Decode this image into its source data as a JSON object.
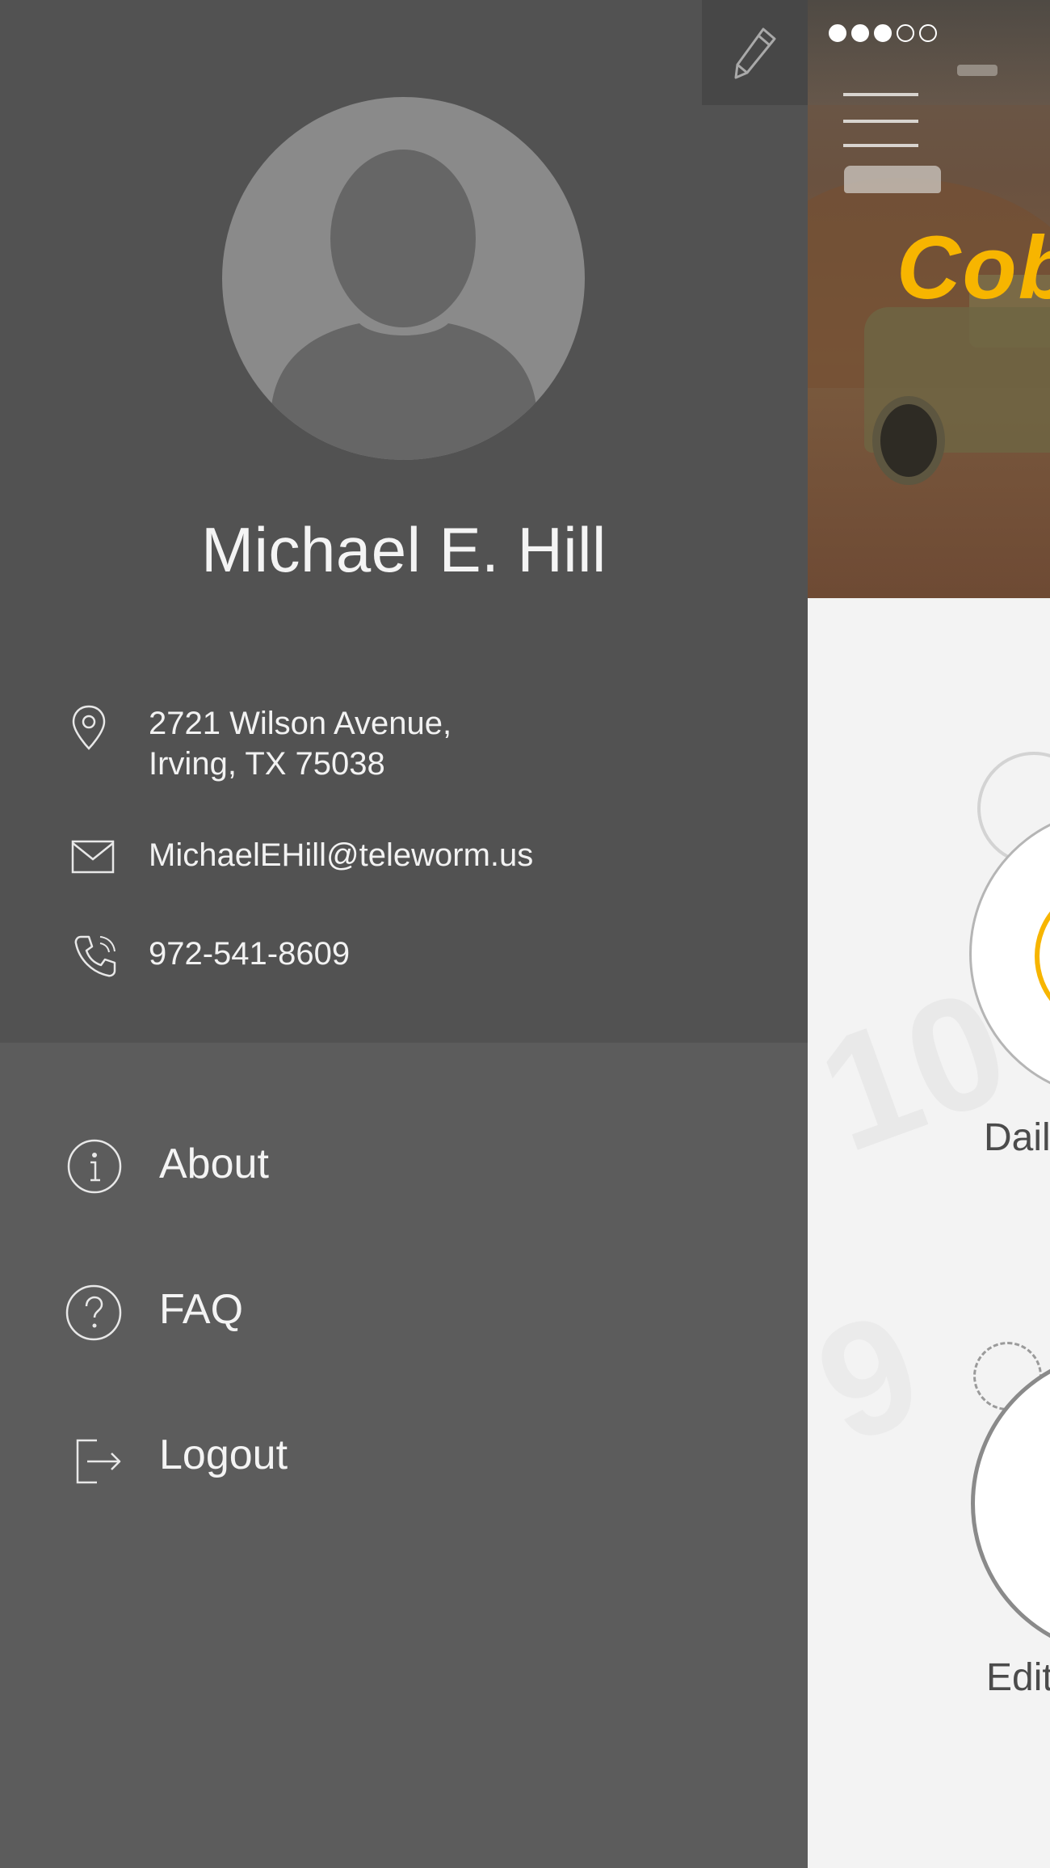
{
  "drawer": {
    "edit_icon": "pencil-icon",
    "avatar_icon": "person-silhouette-icon",
    "user_name": "Michael E. Hill",
    "contact": {
      "address_line1": "2721 Wilson Avenue,",
      "address_line2": "Irving, TX 75038",
      "email": "MichaelEHill@teleworm.us",
      "phone": "972-541-8609"
    },
    "menu": [
      {
        "label": "About",
        "icon": "info-circle-icon"
      },
      {
        "label": "FAQ",
        "icon": "question-circle-icon"
      },
      {
        "label": "Logout",
        "icon": "logout-arrow-icon"
      }
    ]
  },
  "main": {
    "page_dots": {
      "total": 5,
      "filled": 3
    },
    "brand_partial": "Cob",
    "cards": [
      {
        "label": "Dail"
      },
      {
        "label": "Edit"
      }
    ]
  },
  "colors": {
    "drawer_bg": "#5c5c5c",
    "profile_bg": "#525252",
    "accent": "#f7b500"
  }
}
